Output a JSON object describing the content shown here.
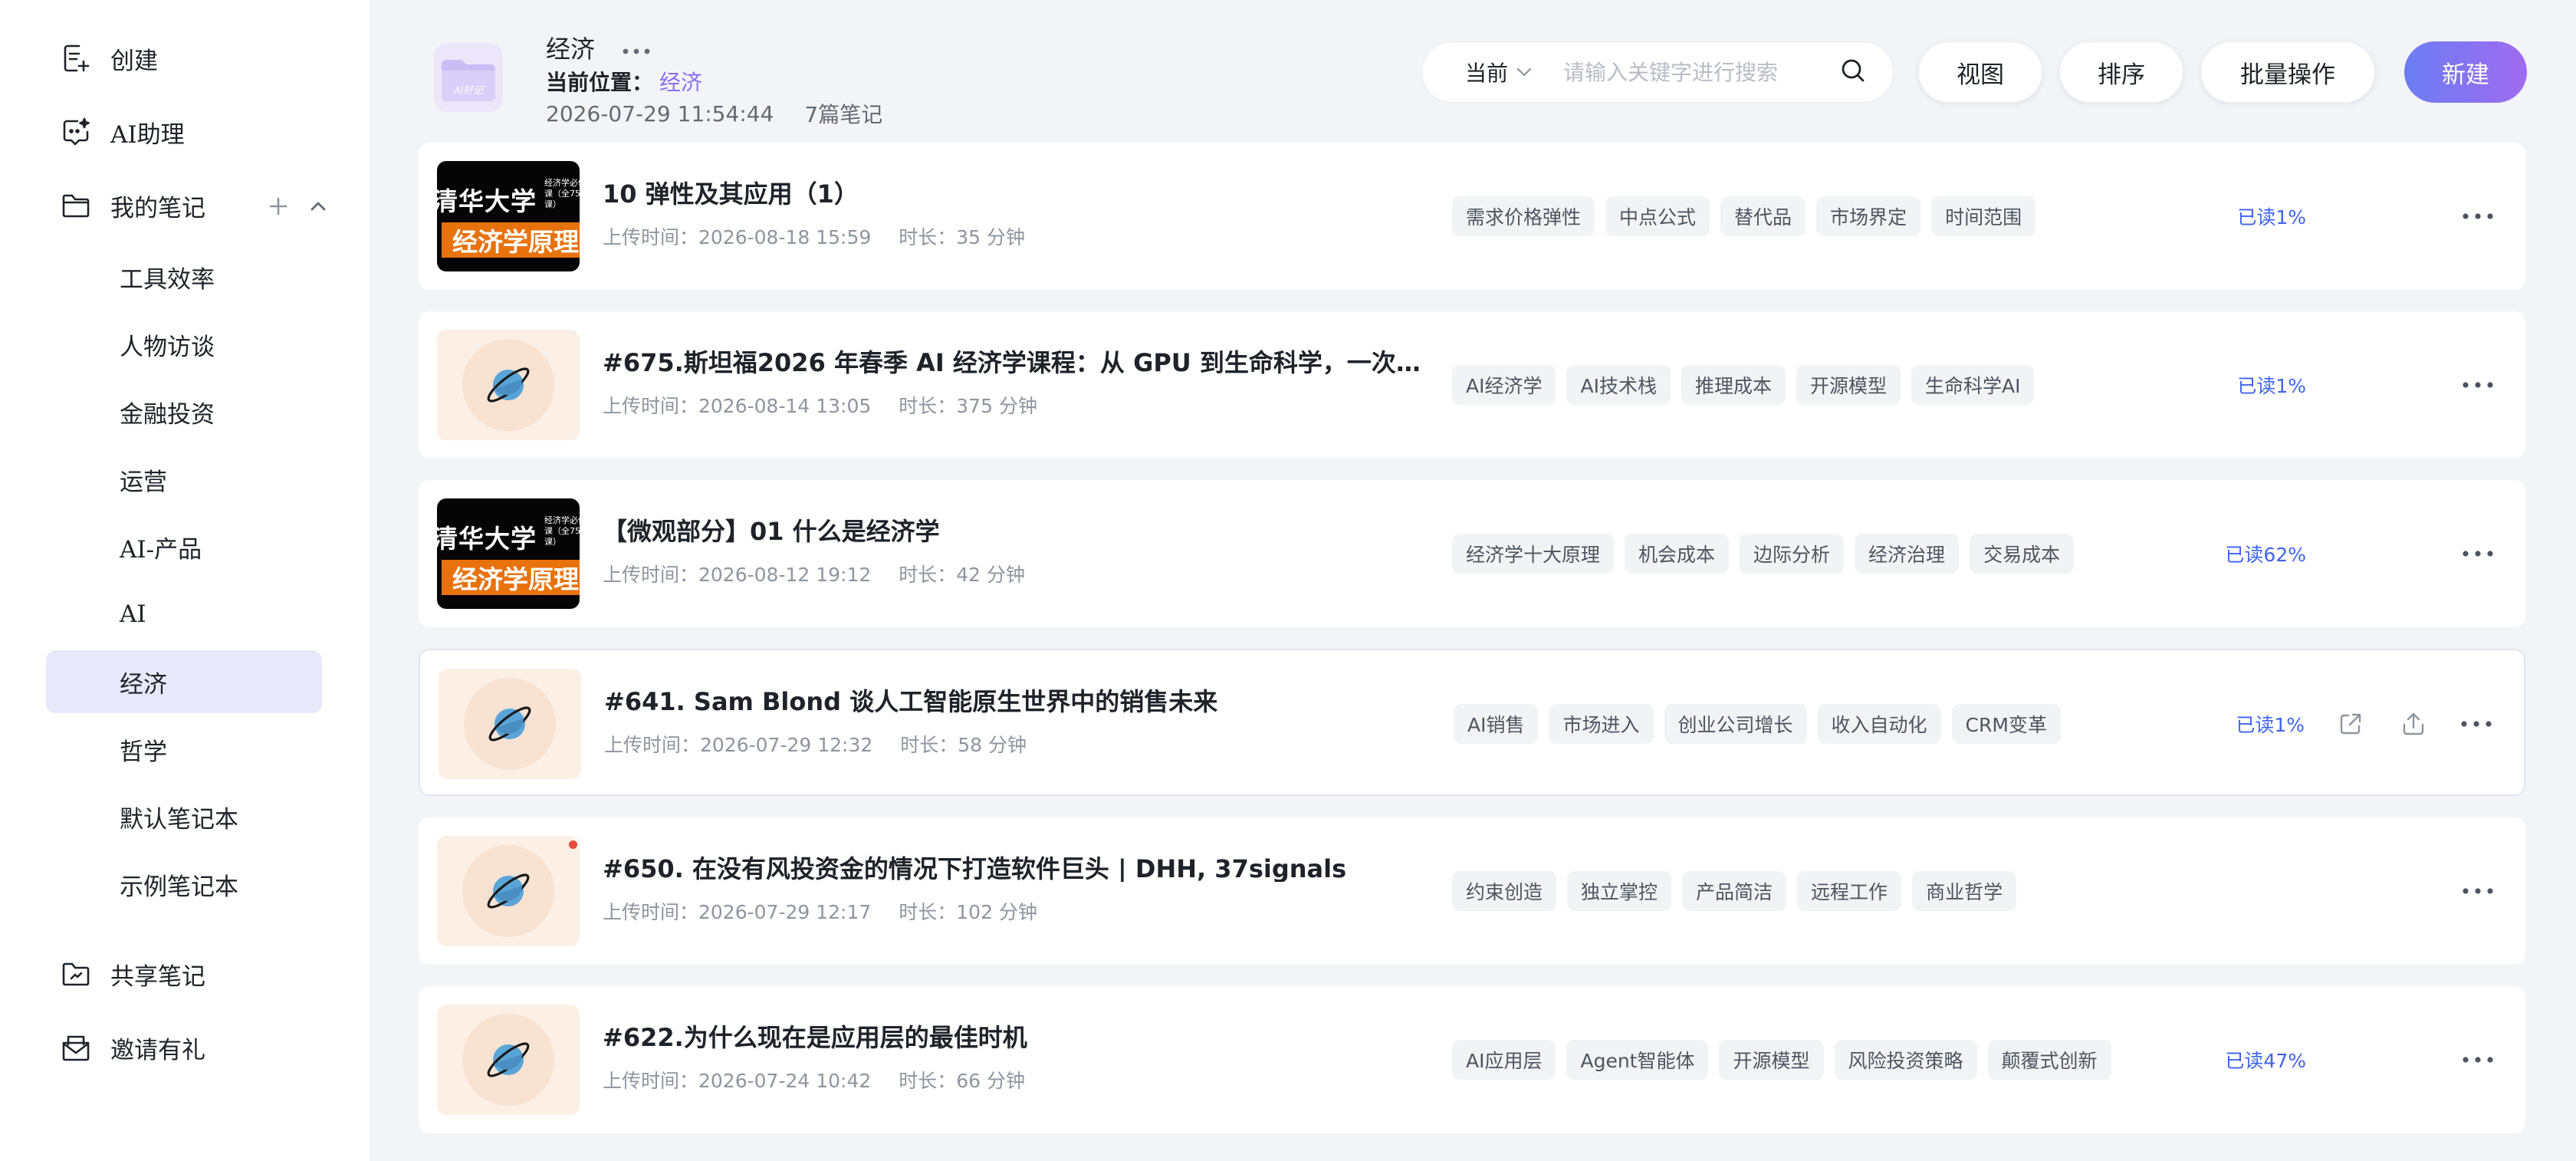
{
  "sidebar": {
    "create_label": "创建",
    "assistant_label": "AI助理",
    "my_notes_label": "我的笔记",
    "notebooks": [
      {
        "label": "工具效率"
      },
      {
        "label": "人物访谈"
      },
      {
        "label": "金融投资"
      },
      {
        "label": "运营"
      },
      {
        "label": "AI-产品"
      },
      {
        "label": "AI"
      },
      {
        "label": "经济",
        "active": true
      },
      {
        "label": "哲学"
      },
      {
        "label": "默认笔记本"
      },
      {
        "label": "示例笔记本"
      }
    ],
    "shared_label": "共享笔记",
    "invite_label": "邀请有礼"
  },
  "header": {
    "logo_text": "AI好记",
    "title": "经济",
    "location_label": "当前位置：",
    "location_value": "经济",
    "timestamp": "2026-07-29 11:54:44",
    "count": "7篇笔记"
  },
  "search": {
    "scope": "当前",
    "placeholder": "请输入关键字进行搜索"
  },
  "toolbar": {
    "view_label": "视图",
    "sort_label": "排序",
    "batch_label": "批量操作",
    "new_label": "新建"
  },
  "cover_text": {
    "school": "清华大学",
    "small": "经济学必修课（全75课）",
    "course": "经济学原理"
  },
  "notes": [
    {
      "title": "10 弹性及其应用（1）",
      "upload": "上传时间：2026-08-18 15:59",
      "duration": "时长：35 分钟",
      "tags": [
        "需求价格弹性",
        "中点公式",
        "替代品",
        "市场界定",
        "时间范围"
      ],
      "read": "已读1%",
      "thumb": "cover"
    },
    {
      "title": "#675.斯坦福2026 年春季 AI 经济学课程：从 GPU 到生命科学，一次听懂 AI 经济学",
      "upload": "上传时间：2026-08-14 13:05",
      "duration": "时长：375 分钟",
      "tags": [
        "AI经济学",
        "AI技术栈",
        "推理成本",
        "开源模型",
        "生命科学AI"
      ],
      "read": "已读1%",
      "thumb": "planet"
    },
    {
      "title": "【微观部分】01 什么是经济学",
      "upload": "上传时间：2026-08-12 19:12",
      "duration": "时长：42 分钟",
      "tags": [
        "经济学十大原理",
        "机会成本",
        "边际分析",
        "经济治理",
        "交易成本"
      ],
      "read": "已读62%",
      "thumb": "cover"
    },
    {
      "title": "#641. Sam Blond 谈人工智能原生世界中的销售未来",
      "upload": "上传时间：2026-07-29 12:32",
      "duration": "时长：58 分钟",
      "tags": [
        "AI销售",
        "市场进入",
        "创业公司增长",
        "收入自动化",
        "CRM变革"
      ],
      "read": "已读1%",
      "thumb": "planet"
    },
    {
      "title": "#650. 在没有风投资金的情况下打造软件巨头 | DHH, 37signals",
      "upload": "上传时间：2026-07-29 12:17",
      "duration": "时长：102 分钟",
      "tags": [
        "约束创造",
        "独立掌控",
        "产品简洁",
        "远程工作",
        "商业哲学"
      ],
      "read": "",
      "thumb": "planet"
    },
    {
      "title": "#622.为什么现在是应用层的最佳时机",
      "upload": "上传时间：2026-07-24 10:42",
      "duration": "时长：66 分钟",
      "tags": [
        "AI应用层",
        "Agent智能体",
        "开源模型",
        "风险投资策略",
        "颠覆式创新"
      ],
      "read": "已读47%",
      "thumb": "planet"
    }
  ],
  "colors": {
    "accent": "#8b6ef5",
    "read_blue": "#3f63f0",
    "active_bg": "#e7e9fb",
    "new_gradient_start": "#6b7df2",
    "new_gradient_end": "#a06bf0"
  }
}
